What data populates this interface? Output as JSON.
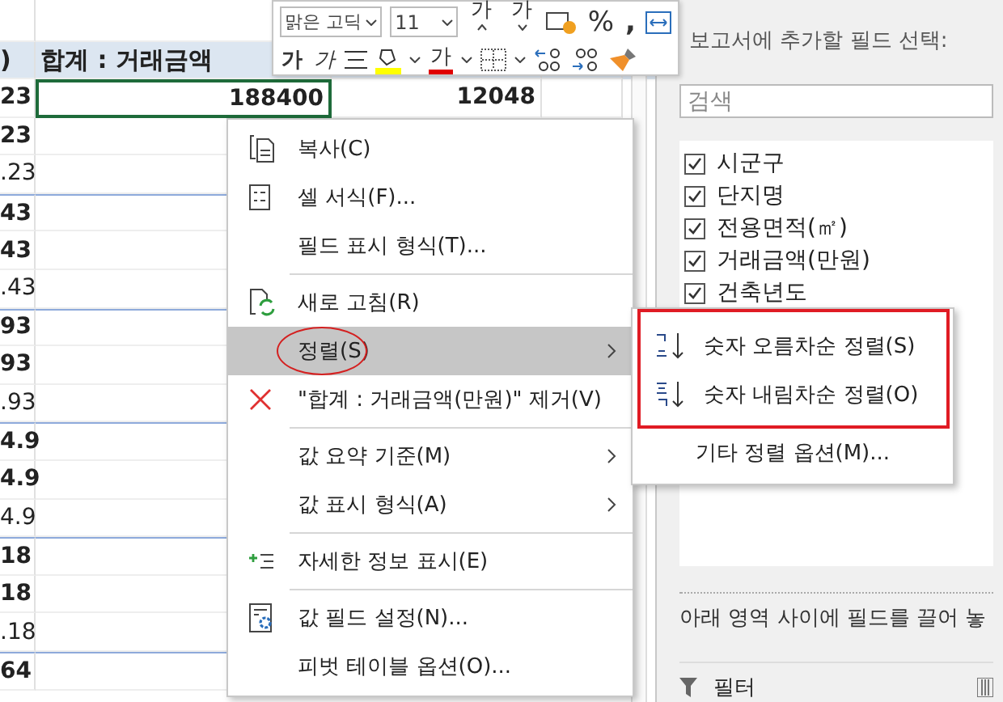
{
  "sheet": {
    "header": [
      ")",
      "합계 : 거래금액"
    ],
    "rows": [
      {
        "bold": true,
        "cells": [
          {
            "text": "23",
            "selected": false
          },
          {
            "text": "188400",
            "selected": true
          },
          {
            "text": "12048",
            "selected": false
          }
        ]
      },
      {
        "bold": true,
        "cells": [
          {
            "text": "23",
            "selected": false
          }
        ]
      },
      {
        "bold": false,
        "cells": [
          {
            "text": ".23",
            "selected": false
          }
        ]
      },
      {
        "bold": true,
        "cells": [
          {
            "text": "43",
            "selected": false
          }
        ]
      },
      {
        "bold": true,
        "cells": [
          {
            "text": "43",
            "selected": false
          }
        ]
      },
      {
        "bold": false,
        "cells": [
          {
            "text": ".43",
            "selected": false
          }
        ]
      },
      {
        "bold": true,
        "cells": [
          {
            "text": "93",
            "selected": false
          }
        ]
      },
      {
        "bold": true,
        "cells": [
          {
            "text": "93",
            "selected": false
          }
        ]
      },
      {
        "bold": false,
        "cells": [
          {
            "text": ".93",
            "selected": false
          }
        ]
      },
      {
        "bold": true,
        "cells": [
          {
            "text": "4.9",
            "selected": false
          }
        ]
      },
      {
        "bold": true,
        "cells": [
          {
            "text": "4.9",
            "selected": false
          }
        ]
      },
      {
        "bold": false,
        "cells": [
          {
            "text": "4.9",
            "selected": false
          }
        ]
      },
      {
        "bold": true,
        "cells": [
          {
            "text": "18",
            "selected": false
          }
        ]
      },
      {
        "bold": true,
        "cells": [
          {
            "text": "18",
            "selected": false
          }
        ]
      },
      {
        "bold": false,
        "cells": [
          {
            "text": ".18",
            "selected": false
          }
        ]
      },
      {
        "bold": true,
        "cells": [
          {
            "text": "64",
            "selected": false
          }
        ]
      }
    ]
  },
  "mini_toolbar": {
    "font": "맑은 고딕",
    "size": "11",
    "grow": "가",
    "shrink": "가",
    "percent": "%",
    "comma": ",",
    "bold": "가",
    "italic": "가",
    "font_color": "가"
  },
  "context_menu": {
    "items": [
      {
        "kind": "item",
        "label": "복사(C)",
        "submenu": false,
        "selected": false,
        "circled": false
      },
      {
        "kind": "item",
        "label": "셀 서식(F)...",
        "submenu": false,
        "selected": false,
        "circled": false
      },
      {
        "kind": "item",
        "label": "필드 표시 형식(T)...",
        "submenu": false,
        "selected": false,
        "circled": false
      },
      {
        "kind": "separator"
      },
      {
        "kind": "item",
        "label": "새로 고침(R)",
        "submenu": false,
        "selected": false,
        "circled": false
      },
      {
        "kind": "item",
        "label": "정렬(S)",
        "submenu": true,
        "selected": true,
        "circled": true
      },
      {
        "kind": "item",
        "label": "\"합계 : 거래금액(만원)\" 제거(V)",
        "submenu": false,
        "selected": false,
        "circled": false
      },
      {
        "kind": "separator"
      },
      {
        "kind": "item",
        "label": "값 요약 기준(M)",
        "submenu": true,
        "selected": false,
        "circled": false
      },
      {
        "kind": "item",
        "label": "값 표시 형식(A)",
        "submenu": true,
        "selected": false,
        "circled": false
      },
      {
        "kind": "separator"
      },
      {
        "kind": "item",
        "label": "자세한 정보 표시(E)",
        "submenu": false,
        "selected": false,
        "circled": false
      },
      {
        "kind": "separator"
      },
      {
        "kind": "item",
        "label": "값 필드 설정(N)...",
        "submenu": false,
        "selected": false,
        "circled": false
      },
      {
        "kind": "item",
        "label": "피벗 테이블 옵션(O)...",
        "submenu": false,
        "selected": false,
        "circled": false
      }
    ]
  },
  "submenu": {
    "boxed": [
      {
        "label": "숫자 오름차순 정렬(S)"
      },
      {
        "label": "숫자 내림차순 정렬(O)"
      }
    ],
    "rest": [
      {
        "label": "기타 정렬 옵션(M)..."
      }
    ]
  },
  "field_pane": {
    "title": "보고서에 추가할 필드 선택:",
    "search_placeholder": "검색",
    "fields": [
      {
        "label": "시군구",
        "checked": true
      },
      {
        "label": "단지명",
        "checked": true
      },
      {
        "label": "전용면적(㎡)",
        "checked": true
      },
      {
        "label": "거래금액(만원)",
        "checked": true
      },
      {
        "label": "건축년도",
        "checked": true
      }
    ],
    "hint": "아래 영역 사이에 필드를 끌어 놓",
    "areas": [
      {
        "label": "필터"
      }
    ]
  }
}
